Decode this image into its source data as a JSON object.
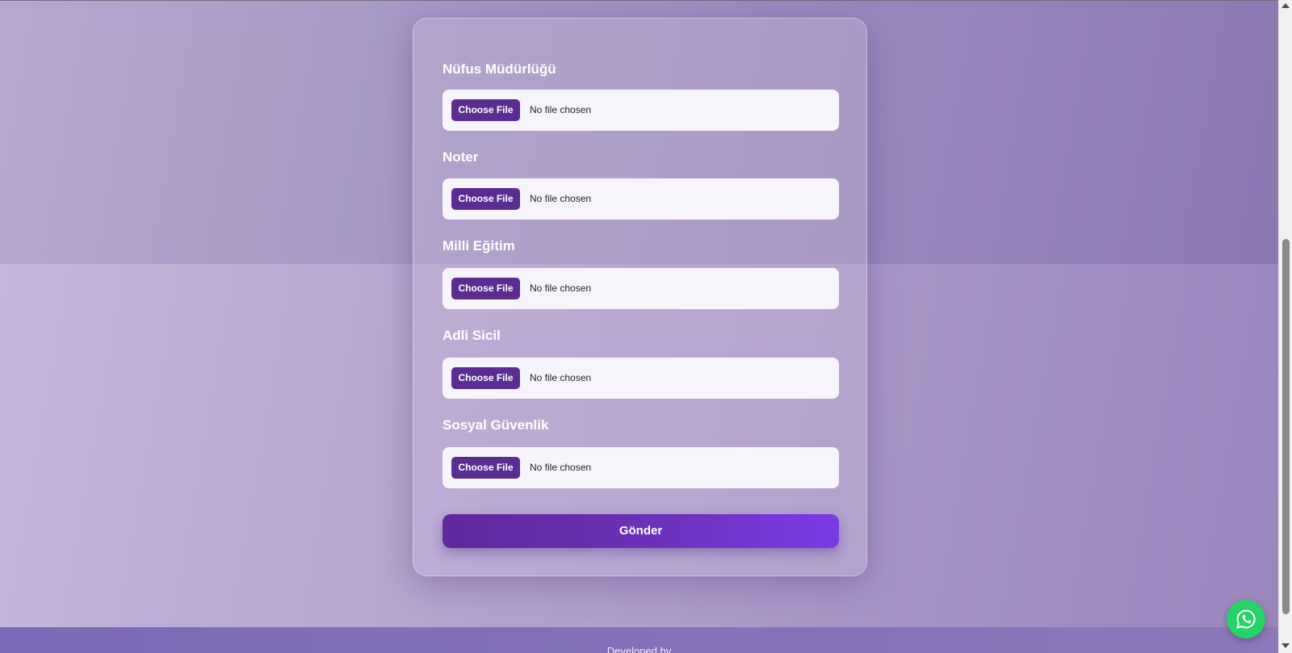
{
  "form": {
    "fields": [
      {
        "label": "Nüfus Müdürlüğü",
        "button": "Choose File",
        "status": "No file chosen"
      },
      {
        "label": "Noter",
        "button": "Choose File",
        "status": "No file chosen"
      },
      {
        "label": "Milli Eğitim",
        "button": "Choose File",
        "status": "No file chosen"
      },
      {
        "label": "Adli Sicil",
        "button": "Choose File",
        "status": "No file chosen"
      },
      {
        "label": "Sosyal Güvenlik",
        "button": "Choose File",
        "status": "No file chosen"
      }
    ],
    "submit_label": "Gönder"
  },
  "footer": {
    "text": "Developed by"
  },
  "whatsapp": {
    "icon": "whatsapp-icon",
    "color": "#25d366"
  },
  "colors": {
    "accent": "#5b2d93",
    "submit_gradient_end": "#7a3be6"
  }
}
